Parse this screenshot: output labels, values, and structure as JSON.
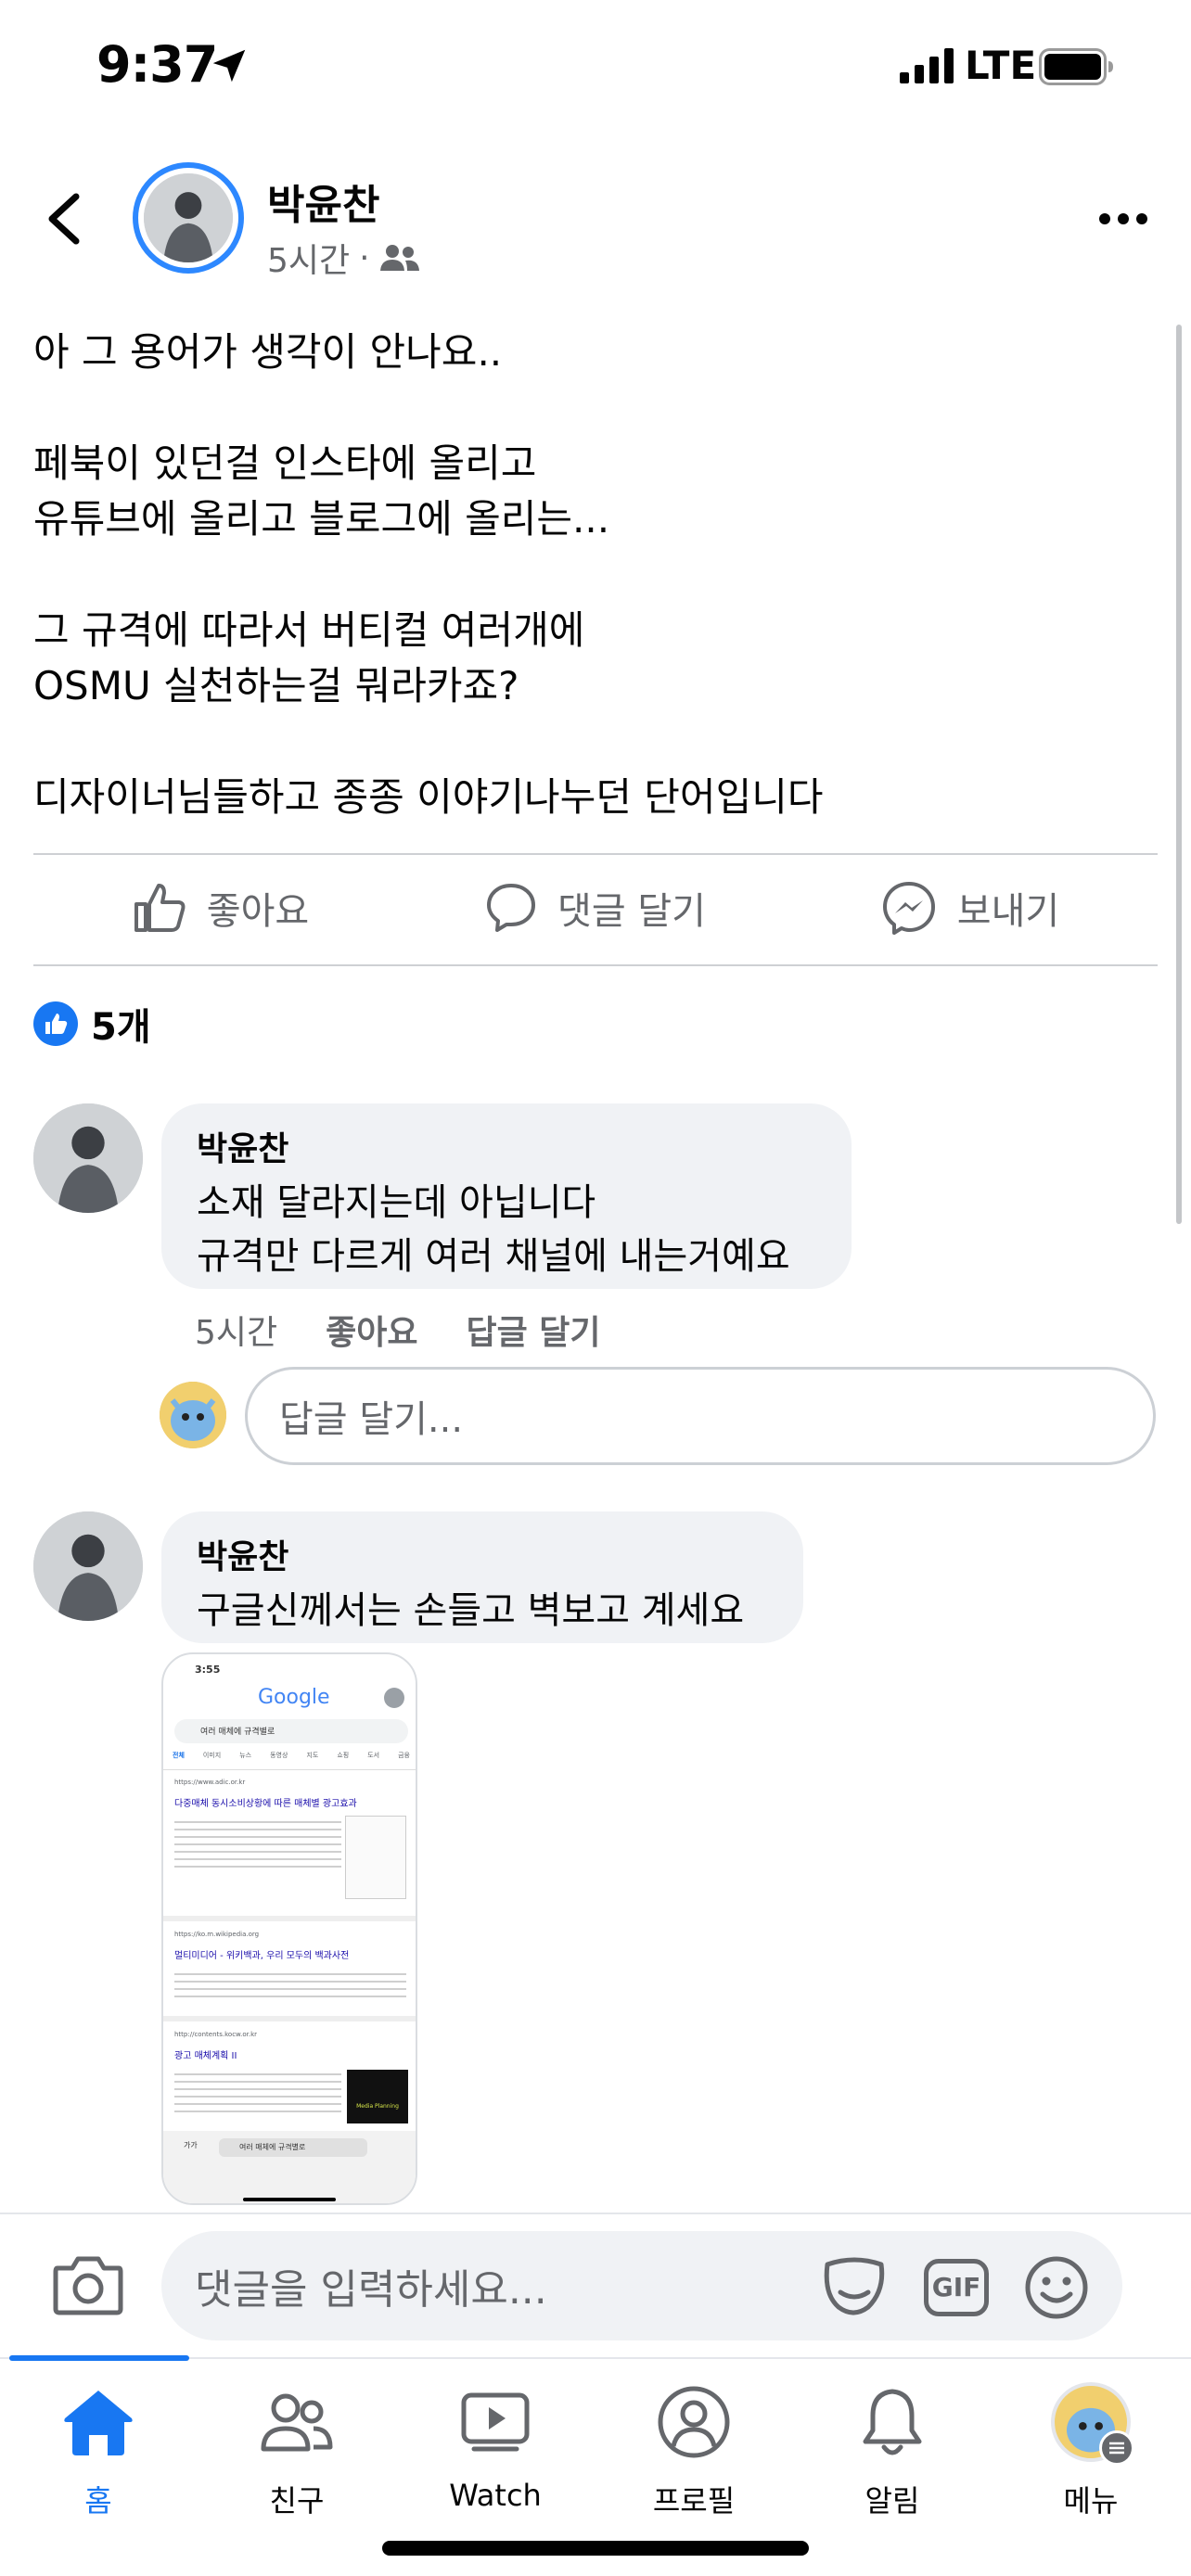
{
  "status_bar": {
    "time": "9:37",
    "network": "LTE"
  },
  "post": {
    "author": "박윤찬",
    "time": "5시간",
    "meta_separator": "·",
    "text": "아 그 용어가 생각이 안나요..\n\n페북이 있던걸 인스타에 올리고\n유튜브에 올리고 블로그에 올리는...\n\n그 규격에 따라서 버티컬 여러개에\nOSMU 실천하는걸 뭐라카죠?\n\n디자이너님들하고 종종 이야기나누던 단어입니다"
  },
  "actions": {
    "like": "좋아요",
    "comment": "댓글 달기",
    "send": "보내기"
  },
  "reactions": {
    "count": "5개"
  },
  "comments": [
    {
      "author": "박윤찬",
      "text": "소재 달라지는데 아닙니다\n규격만 다르게 여러 채널에 내는거예요",
      "time": "5시간",
      "like": "좋아요",
      "reply": "답글 달기"
    },
    {
      "author": "박윤찬",
      "text": "구글신께서는 손들고 벽보고 계세요"
    }
  ],
  "reply_input": {
    "placeholder": "답글 달기..."
  },
  "thumbnail": {
    "time": "3:55",
    "logo": "Google",
    "query": "여러 매체에 규격별로",
    "tabs": [
      "전체",
      "이미지",
      "뉴스",
      "동영상",
      "지도",
      "쇼핑",
      "도서",
      "금융"
    ],
    "results": [
      {
        "url": "https://www.adic.or.kr",
        "title": "다중매체 동시소비상황에 따른 매체별 광고효과"
      },
      {
        "url": "https://ko.m.wikipedia.org",
        "title": "멀티미디어 - 위키백과, 우리 모두의 백과사전"
      },
      {
        "url": "http://contents.kocw.or.kr",
        "title": "광고 매체계획 II"
      }
    ],
    "ad_caption": "Media Planning",
    "address_bar": "여러 매체에 규격별로",
    "aa": "가가"
  },
  "composer": {
    "placeholder": "댓글을 입력하세요...",
    "gif": "GIF"
  },
  "tabs": [
    {
      "label": "홈",
      "icon": "home-icon"
    },
    {
      "label": "친구",
      "icon": "friends-icon"
    },
    {
      "label": "Watch",
      "icon": "watch-icon"
    },
    {
      "label": "프로필",
      "icon": "profile-icon"
    },
    {
      "label": "알림",
      "icon": "bell-icon"
    },
    {
      "label": "메뉴",
      "icon": "menu-avatar-icon"
    }
  ],
  "colors": {
    "accent": "#1877f2",
    "bubble": "#f0f2f5",
    "secondary_text": "#65676b"
  }
}
